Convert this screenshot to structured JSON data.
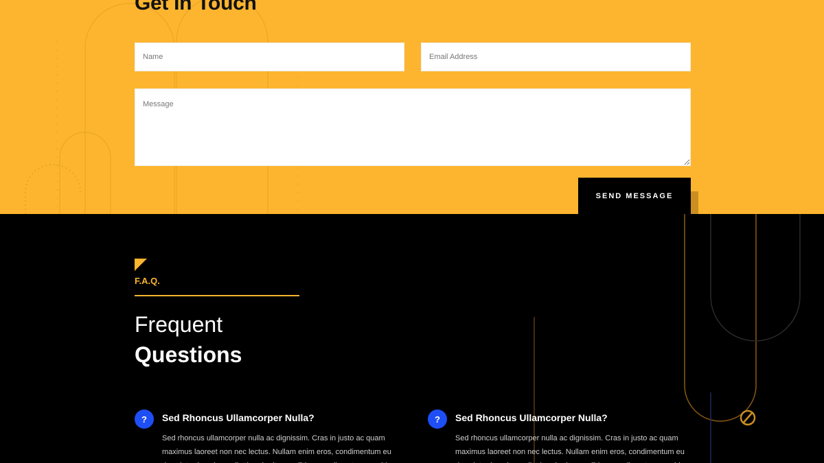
{
  "contact": {
    "title": "Get In Touch",
    "name_placeholder": "Name",
    "email_placeholder": "Email Address",
    "message_placeholder": "Message",
    "send_label": "SEND MESSAGE"
  },
  "faq": {
    "label": "F.A.Q.",
    "heading_light": "Frequent",
    "heading_bold": "Questions",
    "items": [
      {
        "question": "Sed Rhoncus Ullamcorper Nulla?",
        "answer": "Sed rhoncus ullamcorper nulla ac dignissim. Cras in justo ac quam maximus laoreet non nec lectus. Nullam enim eros, condimentum eu risus interdum, imperdiet hendrerit arcu. Etiam condimentum gravida",
        "icon_text": "?"
      },
      {
        "question": "Sed Rhoncus Ullamcorper Nulla?",
        "answer": "Sed rhoncus ullamcorper nulla ac dignissim. Cras in justo ac quam maximus laoreet non nec lectus. Nullam enim eros, condimentum eu risus interdum, imperdiet hendrerit arcu. Etiam condimentum gravida",
        "icon_text": "?"
      }
    ]
  },
  "colors": {
    "accent": "#FDB52F",
    "background_dark": "#000000",
    "icon_blue": "#1E4EF5"
  }
}
